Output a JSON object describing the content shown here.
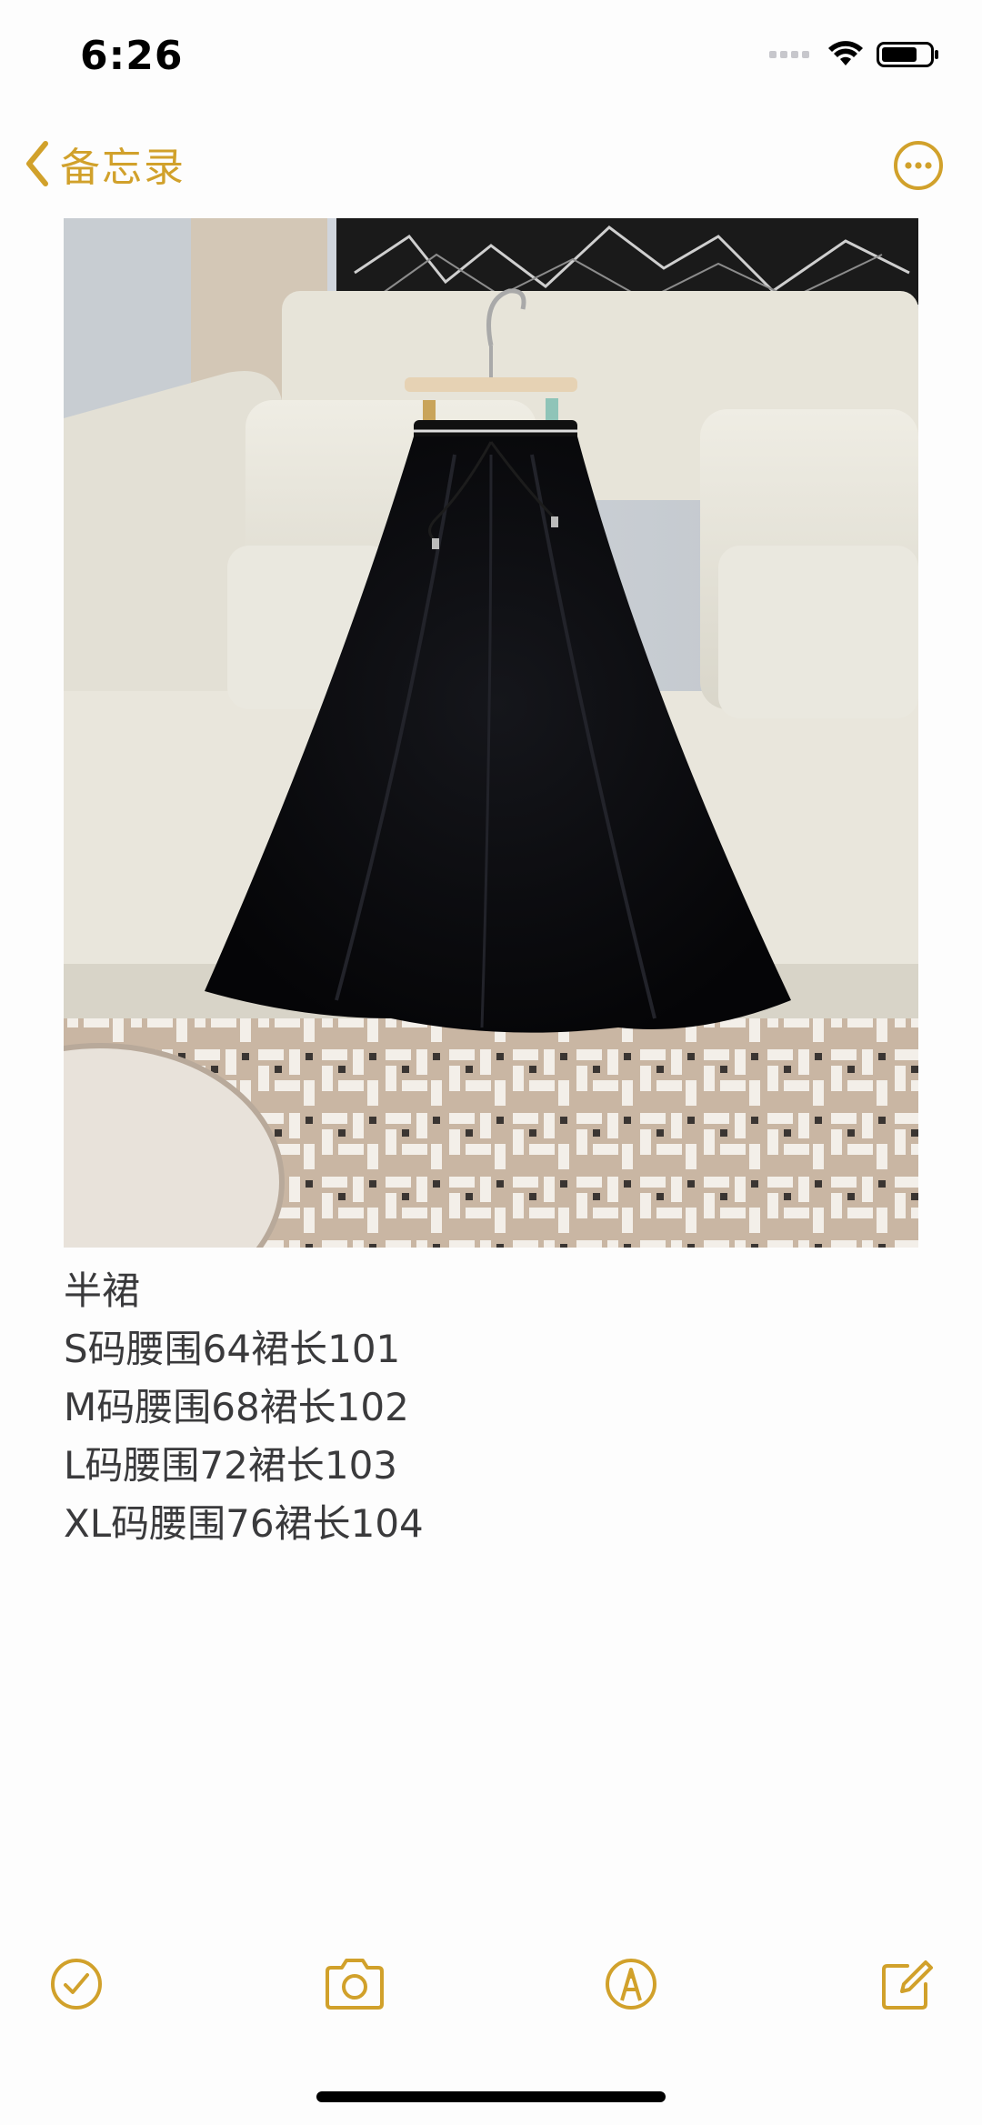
{
  "status_bar": {
    "time": "6:26"
  },
  "nav": {
    "back_label": "备忘录",
    "back_icon": "chevron-left-icon",
    "more_icon": "ellipsis-circle-icon"
  },
  "note": {
    "lines": [
      "半裙",
      "S码腰围64裙长101",
      "M码腰围68裙长102",
      "L码腰围72裙长103",
      "XL码腰围76裙长104"
    ]
  },
  "toolbar": {
    "items": [
      "checklist-icon",
      "camera-icon",
      "markup-icon",
      "compose-icon"
    ]
  },
  "colors": {
    "accent": "#d1a12b",
    "background": "#fdfdfd",
    "text": "#3a3a3c"
  }
}
